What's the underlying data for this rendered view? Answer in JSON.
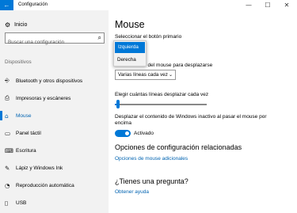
{
  "window": {
    "title": "Configuración",
    "back_glyph": "←",
    "minimize_glyph": "—",
    "maximize_glyph": "☐",
    "close_glyph": "✕"
  },
  "sidebar": {
    "home_label": "Inicio",
    "home_icon": "gear-icon",
    "search_placeholder": "Buscar una configuración",
    "section_label": "Dispositivos",
    "items": [
      {
        "label": "Bluetooth y otros dispositivos",
        "icon": "bluetooth-icon",
        "glyph": "⎆"
      },
      {
        "label": "Impresoras y escáneres",
        "icon": "printer-icon",
        "glyph": "⎙"
      },
      {
        "label": "Mouse",
        "icon": "mouse-icon",
        "glyph": "⌂",
        "active": true
      },
      {
        "label": "Panel táctil",
        "icon": "touchpad-icon",
        "glyph": "▭"
      },
      {
        "label": "Escritura",
        "icon": "keyboard-icon",
        "glyph": "⌨"
      },
      {
        "label": "Lápiz y Windows Ink",
        "icon": "pen-icon",
        "glyph": "✎"
      },
      {
        "label": "Reproducción automática",
        "icon": "autoplay-icon",
        "glyph": "◔"
      },
      {
        "label": "USB",
        "icon": "usb-icon",
        "glyph": "▯"
      }
    ]
  },
  "main": {
    "title": "Mouse",
    "primary_button_label": "Seleccionar el botón primario",
    "primary_button_options": [
      "Izquierda",
      "Derecha"
    ],
    "primary_button_selected": "Izquierda",
    "scroll_wheel_label": "Girar la rueda del mouse para desplazarse",
    "scroll_wheel_value": "Varias líneas cada vez",
    "lines_label": "Elegir cuántas líneas desplazar cada vez",
    "lines_slider_fraction": 0.03,
    "inactive_scroll_label_line1": "Desplazar el contenido de Windows inactivo al pasar el mouse por",
    "inactive_scroll_label_line2": "encima",
    "inactive_scroll_state": "Activado",
    "related_heading": "Opciones de configuración relacionadas",
    "related_link": "Opciones de mouse adicionales",
    "question_heading": "¿Tienes una pregunta?",
    "help_link": "Obtener ayuda"
  },
  "colors": {
    "accent": "#0078d7",
    "sidebar_bg": "#f2f2f2",
    "link": "#0063b1"
  }
}
